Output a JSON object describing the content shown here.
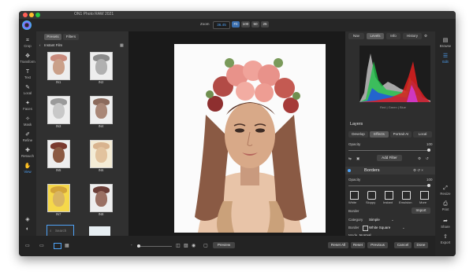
{
  "window": {
    "title": "ON1 Photo RAW 2021"
  },
  "toolbar": {
    "zoom_label": "Zoom",
    "zoom_value": "36.45",
    "zoom_presets": [
      "Fit",
      "100",
      "50",
      "25"
    ]
  },
  "left_rail": [
    {
      "label": "Crop",
      "icon": "crop-icon"
    },
    {
      "label": "Transform",
      "icon": "transform-icon"
    },
    {
      "label": "Text",
      "icon": "text-icon"
    },
    {
      "label": "Local",
      "icon": "brush-icon"
    },
    {
      "label": "Faces",
      "icon": "faces-icon"
    },
    {
      "label": "Mask",
      "icon": "mask-icon"
    },
    {
      "label": "Refine",
      "icon": "refine-icon"
    },
    {
      "label": "Retouch",
      "icon": "retouch-icon"
    },
    {
      "label": "View",
      "icon": "view-icon"
    }
  ],
  "browser": {
    "tabs": [
      "Presets",
      "Filters"
    ],
    "category": "Instant Film",
    "thumbs": [
      "IN1",
      "IN2",
      "IN3",
      "IN4",
      "IN5",
      "IN6",
      "IN7",
      "IN8"
    ],
    "search_placeholder": "Search"
  },
  "right_rail": [
    {
      "label": "Browse",
      "icon": "browse-icon"
    },
    {
      "label": "Edit",
      "icon": "edit-icon"
    },
    {
      "label": "Resize",
      "icon": "resize-icon"
    },
    {
      "label": "Print",
      "icon": "print-icon"
    },
    {
      "label": "Share",
      "icon": "share-icon"
    },
    {
      "label": "Export",
      "icon": "export-icon"
    }
  ],
  "right_panel": {
    "tabs": [
      "Nav",
      "Levels",
      "Info",
      "History"
    ],
    "histogram_channels": "Red | Green | Blue",
    "layers_title": "Layers",
    "edit_tabs": [
      "Develop",
      "Effects",
      "Portrait AI",
      "Local"
    ],
    "opacity_label": "Opacity",
    "opacity_value": "100",
    "add_filter": "Add Filter",
    "borders_title": "Borders",
    "border_styles": [
      "White",
      "Sloppy",
      "Instant",
      "Emulsion",
      "More"
    ],
    "border_label": "Border",
    "import_label": "Import",
    "category_label": "Category",
    "category_value": "Simple",
    "border_value": "White Square",
    "mode_label": "Mode",
    "mode_value": "Normal",
    "opacity2_label": "Opacity",
    "opacity2_value": "100",
    "next_label": "Tone & Color"
  },
  "bottom": {
    "preview": "Preview",
    "reset_all": "Reset All",
    "reset": "Reset",
    "previous": "Previous",
    "cancel": "Cancel",
    "done": "Done"
  },
  "colors": {
    "accent": "#4fa3f7",
    "panel": "#2e2e2e",
    "canvas": "#1a1a1a"
  }
}
